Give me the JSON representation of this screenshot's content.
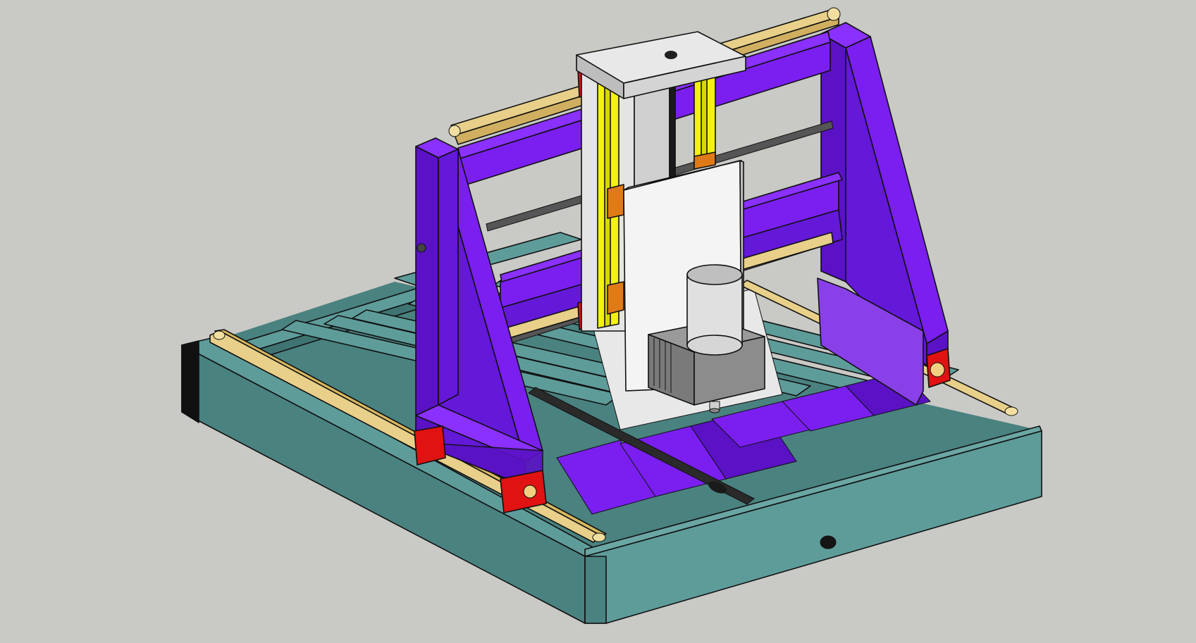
{
  "colors": {
    "background": "#c9c9c5",
    "frame_teal": "#4e8a88",
    "frame_teal_light": "#5e9c9a",
    "frame_teal_dark": "#3f7472",
    "gantry_purple": "#7a1ff0",
    "gantry_purple_dark": "#5a12c4",
    "rail_gold": "#e8d08a",
    "bearing_red": "#e01212",
    "z_rail_yellow": "#f2f20e",
    "z_block_orange": "#e07a16",
    "plate_white": "#f0f0f0",
    "motor_grey": "#8a8a8a",
    "rod_dark": "#3a3a3a"
  },
  "scene": {
    "description_icons": [
      "cnc-router-model"
    ]
  }
}
